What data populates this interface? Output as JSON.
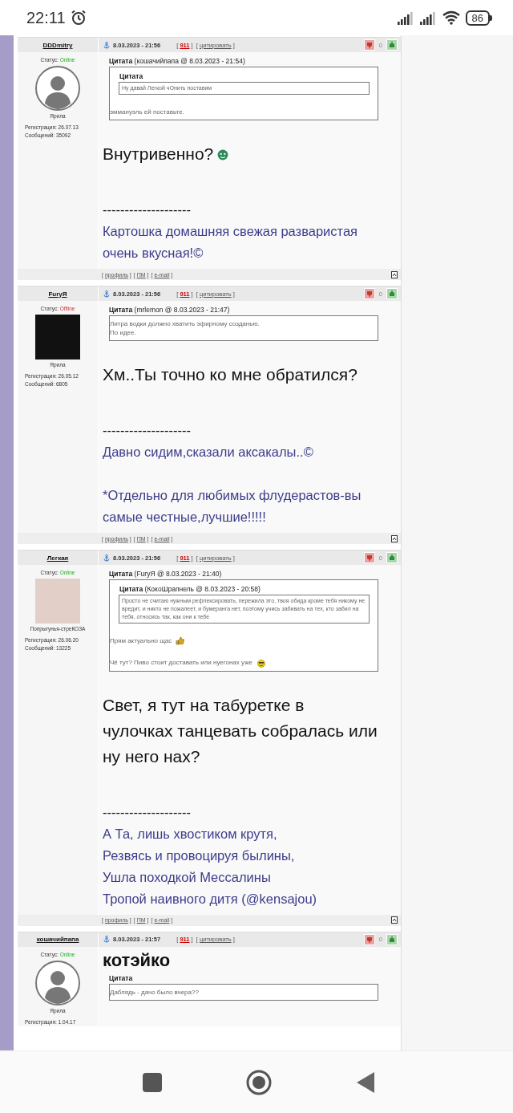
{
  "status_bar": {
    "time": "22:11",
    "battery": "86"
  },
  "brackets": [
    "[",
    "]"
  ],
  "posts": [
    {
      "author": "DDDmitry",
      "status_label": "Статус:",
      "status": "Online",
      "online": true,
      "avatar": {
        "kind": "silhouette"
      },
      "rank": "Ярила",
      "registered": "Регистрация: 26.07.13",
      "messages": "Сообщений: 35092",
      "date": "8.03.2023 - 21:56",
      "report": "911",
      "quote_link": "цитировать",
      "votes": "0",
      "body": [
        {
          "kind": "quote",
          "title": "Цитата",
          "source": "(кошачийпапа @ 8.03.2023 - 21:54)",
          "content": [
            {
              "kind": "quote",
              "title": "Цитата",
              "content": [
                {
                  "kind": "text",
                  "lines": [
                    {
                      "text": "Ну давай Легкой чОнить поставим"
                    }
                  ]
                }
              ]
            },
            {
              "kind": "text",
              "lines": [
                {
                  "text": "эммануэль ей поставьте."
                }
              ]
            }
          ]
        },
        {
          "kind": "text",
          "lines": [
            {
              "text": "Внутривенно?",
              "smiley": {
                "kind": "face-green"
              }
            }
          ]
        }
      ],
      "signature": {
        "rule": "--------------------",
        "paragraphs": [
          [
            "Картошка домашняя свежая разваристая очень вкусная!©"
          ]
        ]
      },
      "footer": [
        "профиль",
        "ПМ",
        "e-mail"
      ]
    },
    {
      "author": "FuryЯ",
      "status_label": "Статус:",
      "status": "Offline",
      "online": false,
      "avatar": {
        "kind": "picture"
      },
      "rank": "Ярила",
      "registered": "Регистрация: 26.05.12",
      "messages": "Сообщений: 6805",
      "date": "8.03.2023 - 21:56",
      "report": "911",
      "quote_link": "цитировать",
      "votes": "0",
      "body": [
        {
          "kind": "quote",
          "title": "Цитата",
          "source": "(mrlemon @ 8.03.2023 - 21:47)",
          "content": [
            {
              "kind": "text",
              "lines": [
                {
                  "text": "Литра водки должно хватить эфирному созданью."
                },
                {
                  "text": "По идее."
                }
              ]
            }
          ]
        },
        {
          "kind": "text",
          "lines": [
            {
              "text": "Хм..Ты точно ко мне обратился?"
            }
          ]
        }
      ],
      "signature": {
        "rule": "--------------------",
        "paragraphs": [
          [
            "Давно сидим,сказали аксакалы..©"
          ],
          [
            "*Отдельно для любимых флудерастов-вы самые честные,лучшие!!!!!"
          ]
        ]
      },
      "footer": [
        "профиль",
        "ПМ",
        "e-mail"
      ]
    },
    {
      "author": "Легкая",
      "status_label": "Статус:",
      "status": "Online",
      "online": true,
      "avatar": {
        "kind": "sketch"
      },
      "rank": "Попрыгунья-стреКОЗА",
      "registered": "Регистрация: 26.06.20",
      "messages": "Сообщений: 13225",
      "date": "8.03.2023 - 21:56",
      "report": "911",
      "quote_link": "цитировать",
      "votes": "0",
      "body": [
        {
          "kind": "quote",
          "title": "Цитата",
          "source": "(FuryЯ @ 8.03.2023 - 21:40)",
          "content": [
            {
              "kind": "quote",
              "title": "Цитата",
              "source": "(КокоШрапнель @ 8.03.2023 - 20:58)",
              "content": [
                {
                  "kind": "text",
                  "lines": [
                    {
                      "text": "Просто не считаю нужным рефлексировать, пережила это, твоя обида кроме тебя никому не вредит, и никто не пожалеет, и бумеранга нет, поэтому учись забивать на тех, кто забил на тебя, относись так, как они к тебе"
                    }
                  ]
                }
              ]
            },
            {
              "kind": "text",
              "lines": [
                {
                  "text": "Прям актуально щас",
                  "smiley": {
                    "kind": "thumbs-up"
                  }
                }
              ]
            },
            {
              "kind": "text",
              "lines": [
                {
                  "text": "Чё тут? Пиво стоит доставать или нуегонах уже",
                  "smiley": {
                    "kind": "face-yellow"
                  }
                }
              ]
            }
          ]
        },
        {
          "kind": "text",
          "lines": [
            {
              "text": "Свет, я тут на табуретке в чулочках танцевать собралась или ну него нах?"
            }
          ]
        }
      ],
      "signature": {
        "rule": "--------------------",
        "paragraphs": [
          [
            "А Та, лишь хвостиком крутя,",
            "Резвясь и провоцируя былины,",
            "Ушла походкой Мессалины",
            "Тропой наивного дитя (@kensajou)"
          ]
        ]
      },
      "footer": [
        "профиль",
        "ПМ",
        "e-mail"
      ]
    },
    {
      "author": "кошачийпапа",
      "status_label": "Статус:",
      "status": "Online",
      "online": true,
      "avatar": {
        "kind": "silhouette"
      },
      "rank": "Ярила",
      "registered": "Регистрация: 1.04.17",
      "date": "8.03.2023 - 21:57",
      "report": "911",
      "quote_link": "цитировать",
      "votes": "0",
      "body": [
        {
          "kind": "heading",
          "text": "котэйко"
        },
        {
          "kind": "quote",
          "title": "Цитата",
          "content": [
            {
              "kind": "text",
              "lines": [
                {
                  "text": "Даблядь - дачо было вчера??"
                }
              ]
            }
          ]
        }
      ]
    }
  ]
}
